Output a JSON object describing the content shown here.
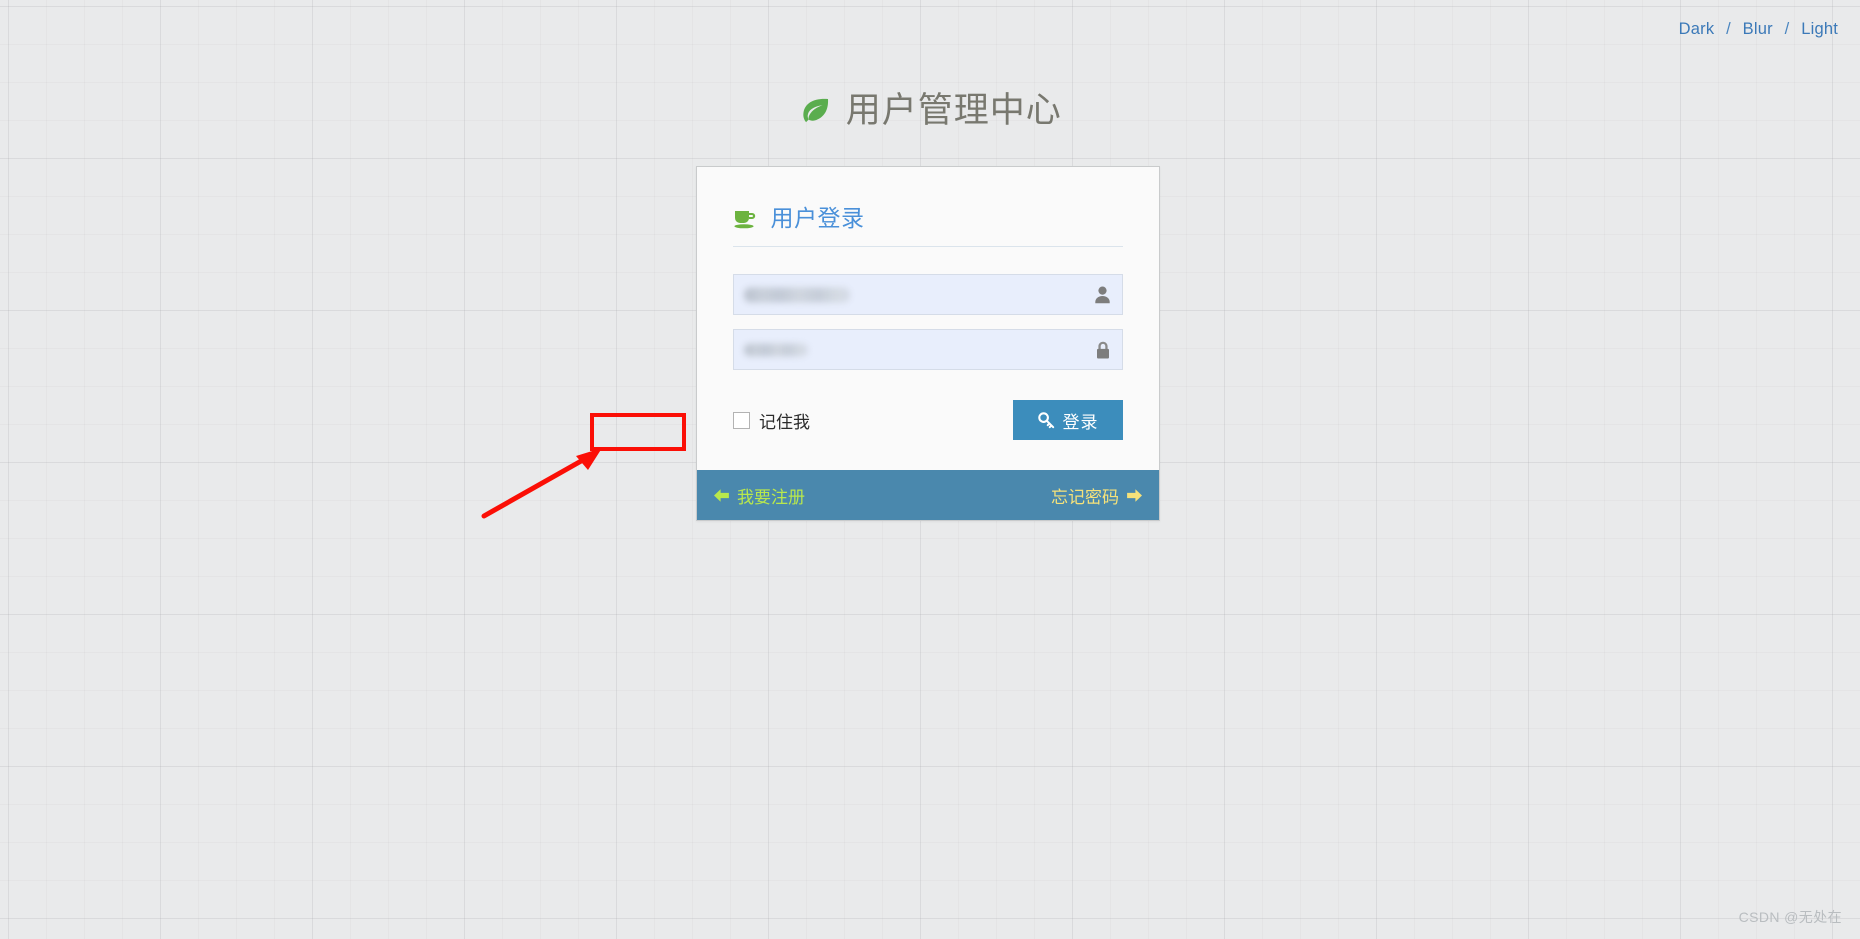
{
  "theme_switcher": {
    "options": [
      "Dark",
      "Blur",
      "Light"
    ],
    "separator": "/",
    "link_color": "#3b79b8"
  },
  "header": {
    "title": "用户管理中心",
    "icon": "leaf-icon",
    "icon_color": "#5aad4e",
    "title_color": "#78786f"
  },
  "login_panel": {
    "heading": "用户登录",
    "heading_icon": "coffee-cup-icon",
    "heading_color": "#4a90d9",
    "username": {
      "value": "",
      "placeholder": "",
      "icon": "user-icon",
      "redacted": true
    },
    "password": {
      "value": "",
      "placeholder": "",
      "icon": "lock-icon",
      "redacted": true
    },
    "remember": {
      "label": "记住我",
      "checked": false
    },
    "submit": {
      "label": "登录",
      "icon": "key-icon",
      "color": "#3c8dbc"
    },
    "footer": {
      "background": "#4a88ad",
      "register": {
        "label": "我要注册",
        "icon": "arrow-left-icon",
        "color": "#b9e84c"
      },
      "forgot": {
        "label": "忘记密码",
        "icon": "arrow-right-icon",
        "color": "#f6e27a"
      }
    }
  },
  "annotation": {
    "color": "#fb0f06",
    "target": "我要注册",
    "shapes": [
      "highlight-rectangle",
      "pointer-arrow"
    ]
  },
  "watermark": {
    "text": "CSDN @无处在"
  }
}
